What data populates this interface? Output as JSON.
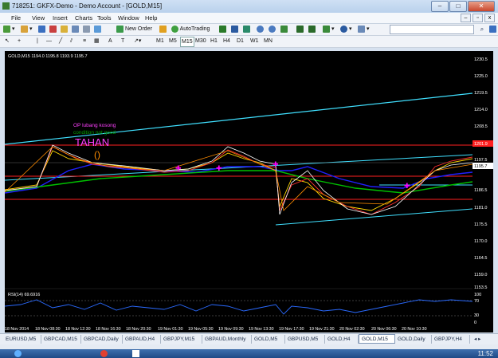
{
  "window": {
    "title": "718251: GKFX-Demo - Demo Account - [GOLD,M15]"
  },
  "menu": [
    "File",
    "View",
    "Insert",
    "Charts",
    "Tools",
    "Window",
    "Help"
  ],
  "toolbar": {
    "new_order": "New Order",
    "autotrading": "AutoTrading",
    "timeframes": [
      "M1",
      "M5",
      "M15",
      "M30",
      "H1",
      "H4",
      "D1",
      "W1",
      "MN"
    ],
    "search_placeholder": ""
  },
  "chart": {
    "header": "GOLD,M15  1194.0 1195.8 1193.9 1195.7",
    "annotations": {
      "op": "OP lubang kosong",
      "good": "condition not good",
      "tahan": "TAHAN"
    },
    "price_labels": [
      "1230.5",
      "1225.0",
      "1219.5",
      "1214.0",
      "1208.5",
      "1203.0",
      "1197.5",
      "1192.0",
      "1186.5",
      "1181.0",
      "1175.5",
      "1170.0",
      "1164.5",
      "1159.0",
      "1153.5"
    ],
    "current_price": "1195.7",
    "level_price_1": "1201.9",
    "time_labels": [
      "18 Nov 2014",
      "18 Nov 08:30",
      "18 Nov 12:30",
      "18 Nov 16:30",
      "18 Nov 20:30",
      "19 Nov 01:30",
      "19 Nov 05:30",
      "19 Nov 09:30",
      "19 Nov 13:30",
      "19 Nov 17:30",
      "19 Nov 21:30",
      "20 Nov 02:30",
      "20 Nov 06:30",
      "20 Nov 10:30"
    ]
  },
  "rsi": {
    "label": "RSI(14) 69.6916",
    "scale": [
      "100",
      "70",
      "30",
      "0"
    ]
  },
  "tabs": [
    "EURUSD,M5",
    "GBPCAD,M15",
    "GBPCAD,Daily",
    "GBPAUD,H4",
    "GBPJPY,M15",
    "GBPAUD,Monthly",
    "GOLD,M5",
    "GBPUSD,M5",
    "GOLD,H4",
    "GOLD,M15",
    "GOLD,Daily",
    "GBPJPY,H4"
  ],
  "active_tab": "GOLD,M15",
  "clock": "11:52",
  "colors": {
    "candle": "#ffffff",
    "cyan": "#40e0ff",
    "red": "#ff2020",
    "green": "#00c000",
    "pink": "#ff00ff",
    "orange": "#ff8c00"
  }
}
